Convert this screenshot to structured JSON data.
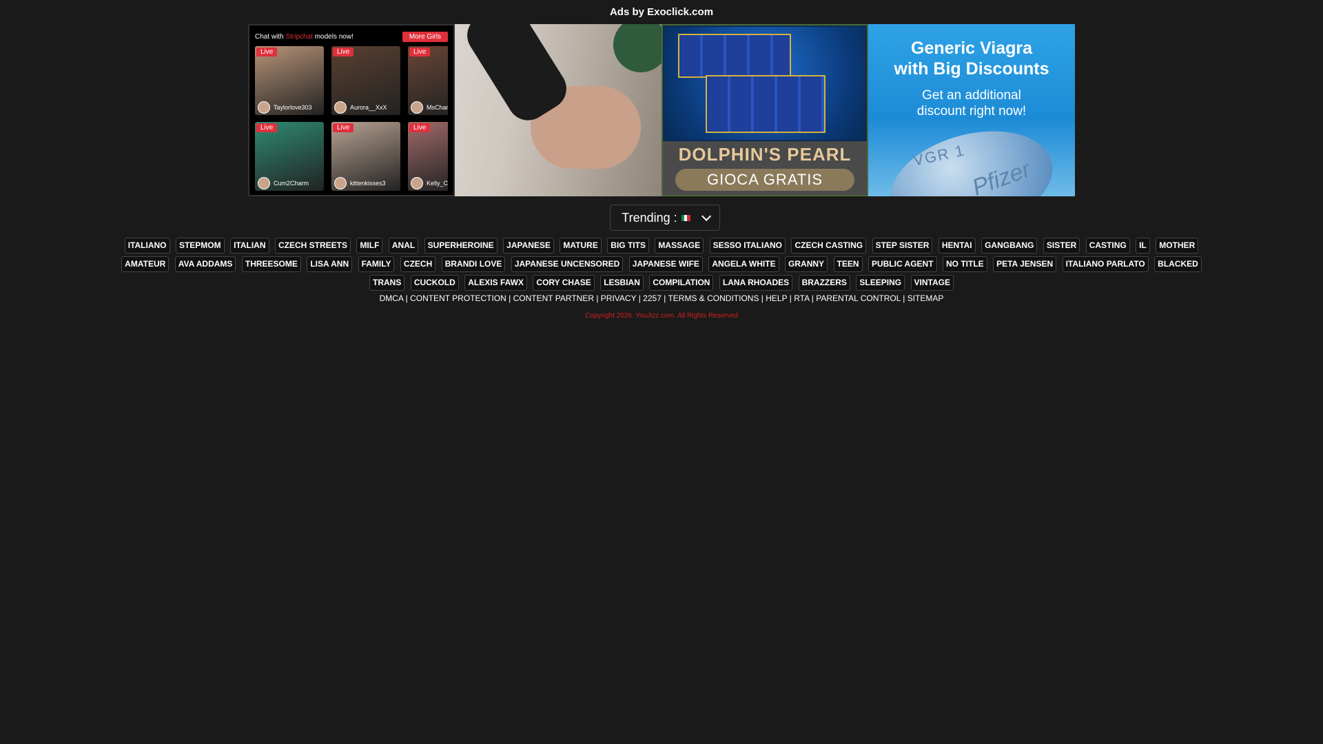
{
  "ads_header": "Ads by Exoclick.com",
  "chat_ad": {
    "prefix": "Chat with ",
    "brand": "Stripchat",
    "suffix": " models now!",
    "more_button": "More Girls",
    "live_badge": "Live",
    "cams": [
      {
        "name": "Taylorlove303",
        "color": "#b89478"
      },
      {
        "name": "Aurora__XxX",
        "color": "#5a4030"
      },
      {
        "name": "MsChane",
        "color": "#6a4535"
      },
      {
        "name": "Cum2Charm",
        "color": "#2f8a72"
      },
      {
        "name": "kittenkisses3",
        "color": "#b8a292"
      },
      {
        "name": "Kelly_Ca",
        "color": "#a06a6a"
      }
    ]
  },
  "slot_ad": {
    "name": "DOLPHIN'S PEARL",
    "cta": "GIOCA GRATIS"
  },
  "pill_ad": {
    "headline_1": "Generic Viagra",
    "headline_2": "with Big Discounts",
    "sub_1": "Get an additional",
    "sub_2": "discount right now!",
    "mark_1": "VGR 1",
    "mark_2": "Pfizer"
  },
  "trending": {
    "label": "Trending :",
    "flag_colors": [
      "#009246",
      "#ffffff",
      "#ce2b37"
    ]
  },
  "tags": [
    "ITALIANO",
    "STEPMOM",
    "ITALIAN",
    "CZECH STREETS",
    "MILF",
    "ANAL",
    "SUPERHEROINE",
    "JAPANESE",
    "MATURE",
    "BIG TITS",
    "MASSAGE",
    "SESSO ITALIANO",
    "CZECH CASTING",
    "STEP SISTER",
    "HENTAI",
    "GANGBANG",
    "SISTER",
    "CASTING",
    "IL",
    "MOTHER",
    "AMATEUR",
    "AVA ADDAMS",
    "THREESOME",
    "LISA ANN",
    "FAMILY",
    "CZECH",
    "BRANDI LOVE",
    "JAPANESE UNCENSORED",
    "JAPANESE WIFE",
    "ANGELA WHITE",
    "GRANNY",
    "TEEN",
    "PUBLIC AGENT",
    "NO TITLE",
    "PETA JENSEN",
    "ITALIANO PARLATO",
    "BLACKED",
    "TRANS",
    "CUCKOLD",
    "ALEXIS FAWX",
    "CORY CHASE",
    "LESBIAN",
    "COMPILATION",
    "LANA RHOADES",
    "BRAZZERS",
    "SLEEPING",
    "VINTAGE"
  ],
  "footer_links": [
    "DMCA",
    "CONTENT PROTECTION",
    "CONTENT PARTNER",
    "PRIVACY",
    "2257",
    "TERMS & CONDITIONS",
    "HELP",
    "RTA",
    "PARENTAL CONTROL",
    "SITEMAP"
  ],
  "copyright": "Copyright 2026. YouJizz.com. All Rights Reserved"
}
